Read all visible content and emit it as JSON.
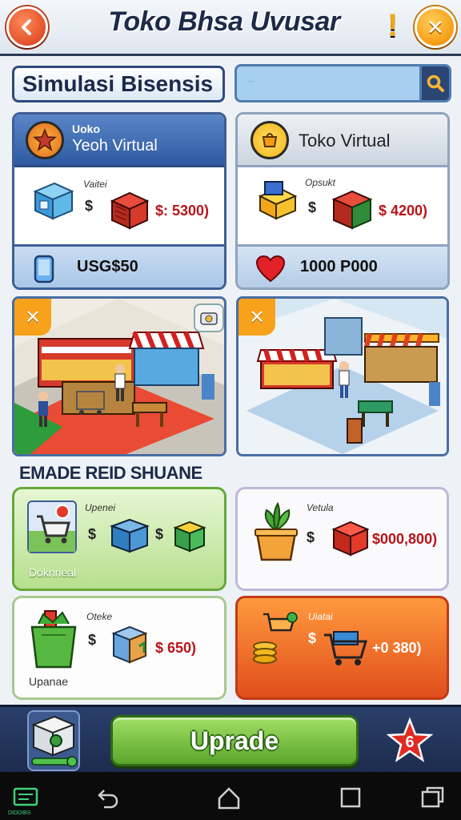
{
  "header": {
    "title": "Toko Bhsa Uvusar",
    "alert": "!",
    "back_icon": "back-arrow-icon",
    "close_icon": "close-icon",
    "close_glyph": "✕"
  },
  "section": {
    "title": "Simulasi Bisensis"
  },
  "search": {
    "placeholder": "···",
    "icon": "search-icon"
  },
  "shops": [
    {
      "head_small": "Uoko",
      "head_big": "Yeoh Virtual",
      "body_label": "Vaitei",
      "symbol": "$",
      "price": "$: 5300)",
      "footer": "USG$50",
      "badge_icon": "star-badge-icon",
      "footer_icon": "phone-icon"
    },
    {
      "head_small": "",
      "head_big": "Toko Virtual",
      "body_label": "Opsukt",
      "symbol": "$",
      "price": "$ 4200)",
      "footer": "1000 P000",
      "badge_icon": "shop-badge-icon",
      "footer_icon": "heart-icon"
    }
  ],
  "scenes": {
    "close_glyph": "✕"
  },
  "upgrades_section": {
    "title": "EMADE REID SHUANE"
  },
  "upgrades": [
    {
      "label": "Upenei",
      "symbol1": "$",
      "symbol2": "$",
      "bottom": "Doknneal",
      "icon": "shopping-cart-icon"
    },
    {
      "label": "Vetula",
      "symbol1": "$",
      "price": "$000,800)",
      "icon": "plant-pot-icon"
    },
    {
      "label": "Oteke",
      "symbol1": "$",
      "price": "$ 650)",
      "bottom": "Upanae",
      "icon": "shopping-bag-icon"
    },
    {
      "label": "Uiatai",
      "symbol1": "$",
      "price": "+0 380)",
      "icon": "coins-cart-icon"
    }
  ],
  "actionbar": {
    "upgrade_label": "Uprade",
    "star_count": "6",
    "machine_icon": "machine-icon"
  },
  "navbar": {
    "app_label": "DIDDIBS",
    "items": [
      "app-icon",
      "back-icon",
      "home-icon",
      "recents-icon",
      "overview-icon"
    ]
  },
  "colors": {
    "accent_orange": "#f59d12",
    "header_blue": "#2e5aa0",
    "upgrade_green": "#5ba42c",
    "price_red": "#b8141a"
  }
}
